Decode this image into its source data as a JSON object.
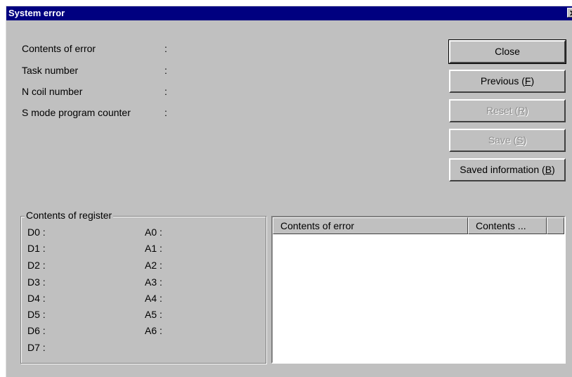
{
  "window": {
    "title": "System error",
    "close_glyph": "✕"
  },
  "info": {
    "rows": [
      {
        "label": "Contents of error",
        "sep": ":"
      },
      {
        "label": "Task number",
        "sep": ":"
      },
      {
        "label": "N coil number",
        "sep": ":"
      },
      {
        "label": "S mode program counter",
        "sep": ":"
      }
    ]
  },
  "buttons": {
    "close": "Close",
    "previous": {
      "text": "Previous (",
      "key": "F",
      "end": ")"
    },
    "reset": {
      "text": "Reset (",
      "key": "R",
      "end": ")"
    },
    "save": {
      "text": "Save (",
      "key": "S",
      "end": ")"
    },
    "saved_info": {
      "text": "Saved information (",
      "key": "B",
      "end": ")"
    }
  },
  "registers": {
    "legend": "Contents of register",
    "d": [
      "D0 :",
      "D1 :",
      "D2 :",
      "D3 :",
      "D4 :",
      "D5 :",
      "D6 :",
      "D7 :"
    ],
    "a": [
      "A0 :",
      "A1 :",
      "A2 :",
      "A3 :",
      "A4 :",
      "A5 :",
      "A6 :"
    ]
  },
  "list": {
    "columns": [
      "Contents of error",
      "Contents ...",
      ""
    ]
  }
}
